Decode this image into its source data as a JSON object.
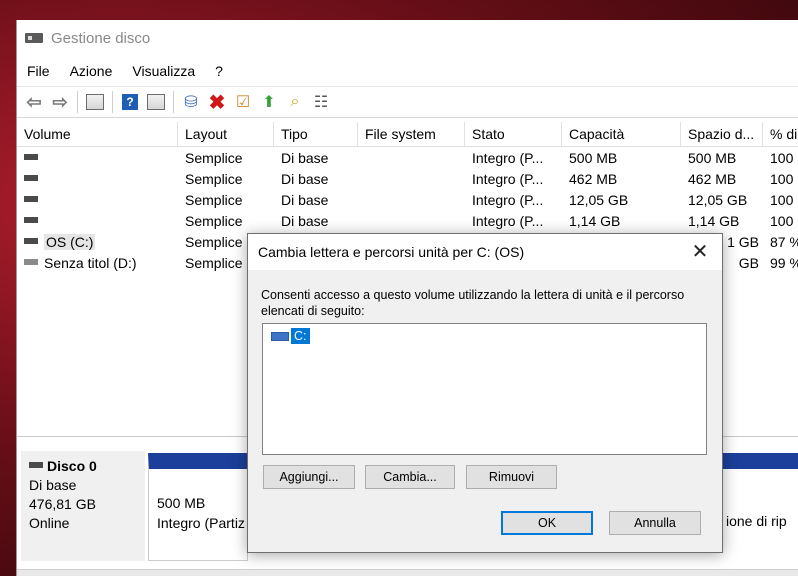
{
  "window": {
    "title": "Gestione disco"
  },
  "menu": [
    "File",
    "Azione",
    "Visualizza",
    "?"
  ],
  "toolbar": {
    "icons": [
      "back-icon",
      "forward-icon",
      "console-tree-icon",
      "help-icon",
      "show-hide-icon",
      "connect-drive-icon",
      "delete-icon",
      "properties-icon",
      "export-icon",
      "find-icon",
      "list-view-icon"
    ]
  },
  "table": {
    "columns": [
      "Volume",
      "Layout",
      "Tipo",
      "File system",
      "Stato",
      "Capacità",
      "Spazio d...",
      "% di"
    ],
    "rows": [
      {
        "volume": "",
        "layout": "Semplice",
        "tipo": "Di base",
        "fs": "",
        "stato": "Integro (P...",
        "capacita": "500 MB",
        "spazio": "500 MB",
        "pct": "100"
      },
      {
        "volume": "",
        "layout": "Semplice",
        "tipo": "Di base",
        "fs": "",
        "stato": "Integro (P...",
        "capacita": "462 MB",
        "spazio": "462 MB",
        "pct": "100"
      },
      {
        "volume": "",
        "layout": "Semplice",
        "tipo": "Di base",
        "fs": "",
        "stato": "Integro (P...",
        "capacita": "12,05 GB",
        "spazio": "12,05 GB",
        "pct": "100"
      },
      {
        "volume": "",
        "layout": "Semplice",
        "tipo": "Di base",
        "fs": "",
        "stato": "Integro (P...",
        "capacita": "1,14 GB",
        "spazio": "1,14 GB",
        "pct": "100"
      },
      {
        "volume": "OS (C:)",
        "layout": "Semplice",
        "tipo": "",
        "fs": "",
        "stato": "",
        "capacita": "",
        "spazio": "1 GB",
        "pct": "87 %"
      },
      {
        "volume": "Senza titol (D:)",
        "layout": "Semplice",
        "tipo": "",
        "fs": "",
        "stato": "",
        "capacita": "",
        "spazio": "GB",
        "pct": "99 %"
      }
    ]
  },
  "disk": {
    "title": "Disco 0",
    "type": "Di base",
    "size": "476,81 GB",
    "status": "Online",
    "partition": {
      "size": "500 MB",
      "status": "Integro (Partiz"
    },
    "right_fragment": "ione di rip"
  },
  "dialog": {
    "title": "Cambia lettera e percorsi unità per C: (OS)",
    "description": "Consenti accesso a questo volume utilizzando la lettera di unità e il percorso elencati di seguito:",
    "entries": [
      "C:"
    ],
    "buttons": {
      "add": "Aggiungi...",
      "change": "Cambia...",
      "remove": "Rimuovi",
      "ok": "OK",
      "cancel": "Annulla"
    },
    "close_glyph": "✕"
  }
}
